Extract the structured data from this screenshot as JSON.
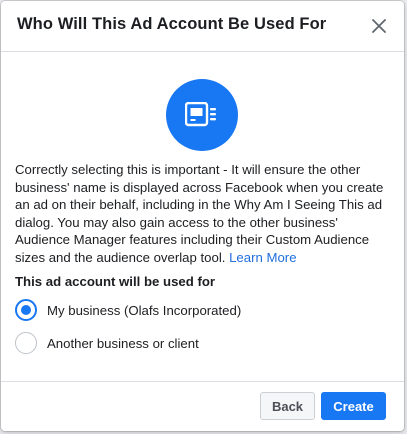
{
  "dialog": {
    "title": "Who Will This Ad Account Be Used For",
    "close_icon": "close-icon",
    "hero_icon": "ad-account-icon",
    "description": "Correctly selecting this is important - It will ensure the other business' name is displayed across Facebook when you create an ad on their behalf, including in the Why Am I Seeing This ad dialog. You may also gain access to the other business' Audience Manager features including their Custom Audience sizes and the audience overlap tool.",
    "learn_more": "Learn More",
    "question": "This ad account will be used for",
    "options": [
      {
        "label": "My business (Olafs Incorporated)",
        "selected": true
      },
      {
        "label": "Another business or client",
        "selected": false
      }
    ],
    "buttons": {
      "back": "Back",
      "create": "Create"
    }
  },
  "colors": {
    "accent": "#1877f2",
    "link": "#216fdb",
    "text": "#1c1e21",
    "border": "#dadde1"
  }
}
